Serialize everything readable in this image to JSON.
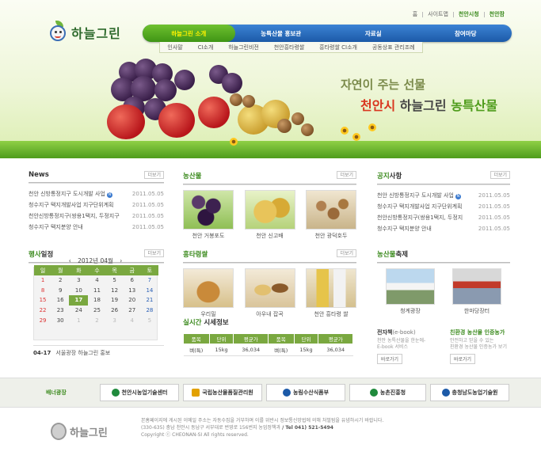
{
  "logo": {
    "text": "하늘그린"
  },
  "util": {
    "items": [
      "홈",
      "사이트맵",
      "천안시청",
      "천안팜"
    ]
  },
  "gnb": {
    "items": [
      "하늘그린 소개",
      "농특산물 홍보관",
      "자료실",
      "참여마당"
    ]
  },
  "lnb": {
    "items": [
      "인사말",
      "CI소개",
      "하늘그린비전",
      "천안흥타령쌀",
      "흥타령쌀 CI소개",
      "공동상표 관리조례"
    ]
  },
  "visual": {
    "slogan1": "자연이 주는 선물",
    "slogan2_a": "천안시",
    "slogan2_b": " 하늘그린 ",
    "slogan2_c": "농특산물"
  },
  "more_label": "더보기",
  "news": {
    "title": "News",
    "items": [
      {
        "text": "천안 신방통정지구 도시개발 사업",
        "new": "N",
        "date": "2011.05.05"
      },
      {
        "text": "청수지구 택지개발사업 지구단위계획",
        "date": "2011.05.05"
      },
      {
        "text": "천안신방통정지구(쌍용1택지, 두정지구",
        "date": "2011.05.05"
      },
      {
        "text": "청수지구 택지분양 안내",
        "date": "2011.05.05"
      }
    ]
  },
  "products": {
    "title": "농산물",
    "items": [
      "천안 거봉포도",
      "천안 신고배",
      "천안 광덕호두"
    ]
  },
  "notice": {
    "title_a": "공지",
    "title_b": "사항",
    "items": [
      {
        "text": "천안 신방통정지구 도시개발 사업",
        "new": "N",
        "date": "2011.05.05"
      },
      {
        "text": "청수지구 택지개발사업 지구단위계획",
        "date": "2011.05.05"
      },
      {
        "text": "천안신방통정지구(쌍용1택지, 두정지",
        "date": "2011.05.05"
      },
      {
        "text": "청수지구 택지분양 안내",
        "date": "2011.05.05"
      }
    ]
  },
  "events": {
    "title_a": "행사",
    "title_b": "일정",
    "month": "2012년 04월",
    "weekdays": [
      "일",
      "월",
      "화",
      "수",
      "목",
      "금",
      "토"
    ],
    "weeks": [
      [
        "1",
        "2",
        "3",
        "4",
        "5",
        "6",
        "7"
      ],
      [
        "8",
        "9",
        "10",
        "11",
        "12",
        "13",
        "14"
      ],
      [
        "15",
        "16",
        "17",
        "18",
        "19",
        "20",
        "21"
      ],
      [
        "22",
        "23",
        "24",
        "25",
        "26",
        "27",
        "28"
      ],
      [
        "29",
        "30",
        "1",
        "2",
        "3",
        "4",
        "5"
      ]
    ],
    "today": "17",
    "event_date": "04-17",
    "event_text": "서울광장 하늘그린 홍보"
  },
  "rice": {
    "title": "흥타령쌀",
    "items": [
      "우리밀",
      "아우내 잡곡",
      "천안 흥타령 쌀"
    ]
  },
  "price": {
    "title_a": "실시간",
    "title_b": " 시세정보",
    "headers": [
      "품목",
      "단위",
      "평균가",
      "품목",
      "단위",
      "평균가"
    ],
    "row": [
      "벼(특)",
      "15kg",
      "36,034",
      "벼(특)",
      "15kg",
      "36,034"
    ]
  },
  "festival": {
    "title_a": "농산물",
    "title_b": "축제",
    "items": [
      "청계광장",
      "한마당장터"
    ]
  },
  "ebook": {
    "title_a": "전자책",
    "title_b": "(e-book)",
    "desc": [
      "천안 농특산물을 한눈에-",
      "E-book 서비스"
    ],
    "btn": "바로가기"
  },
  "cert": {
    "title": "친환경 농산물 인증농가",
    "desc": [
      "안전하고 믿을 수 있는",
      "친환경 농산물 인증농가 보기"
    ],
    "btn": "바로가기"
  },
  "banner": {
    "label": "배너광장",
    "items": [
      "천안시농업기술센터",
      "국립농산물품질관리원",
      "농림수산식품부",
      "농촌진흥청",
      "충청남도농업기술원"
    ],
    "colors": [
      "#1f8a3c",
      "#e2a100",
      "#1c5aa8",
      "#1f8a3c",
      "#1c5aa8"
    ]
  },
  "footer": {
    "logo": "하늘그린",
    "line1": "본홈페이지에 게시된 이메일 주소는 자동수집을 거부하며 이를 위반시 정보통신망법에 의해 처벌됨을 유념하시기 바랍니다.",
    "line2": "(330-635) 충남 천안시 동남구 서부대로 번영로 156번지 농업정책과",
    "line2_tel": " / Tel 041) 521-5494",
    "copyright": "Copyright ⓒ CHEONAN-SI All rights reserved."
  }
}
